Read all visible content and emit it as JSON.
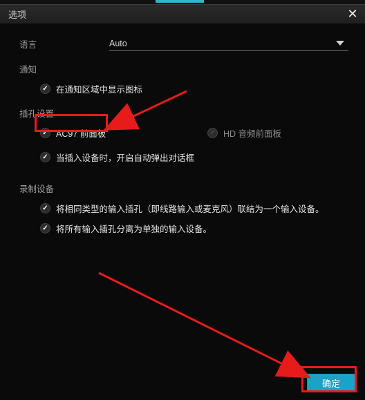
{
  "titlebar": {
    "title": "选项"
  },
  "language": {
    "label": "语言",
    "value": "Auto"
  },
  "notify": {
    "section": "通知",
    "show_tray": {
      "checked": true,
      "label": "在通知区域中显示图标"
    }
  },
  "jack": {
    "section": "插孔设置",
    "ac97": {
      "checked": true,
      "label": "AC97 前面板"
    },
    "hd": {
      "checked": false,
      "label": "HD 音频前面板"
    },
    "popup": {
      "checked": true,
      "label": "当插入设备时，开启自动弹出对话框"
    }
  },
  "record": {
    "section": "录制设备",
    "tie": {
      "checked": true,
      "label": "将相同类型的输入插孔（即线路输入或麦克风）联结为一个输入设备。"
    },
    "split": {
      "checked": true,
      "label": "将所有输入插孔分离为单独的输入设备。"
    }
  },
  "buttons": {
    "ok": "确定"
  }
}
